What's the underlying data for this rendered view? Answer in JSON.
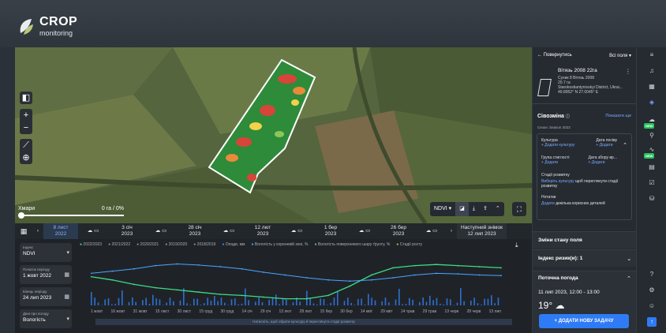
{
  "brand": {
    "name": "CROP",
    "sub": "monitoring"
  },
  "map": {
    "clouds_label": "Хмари",
    "clouds_value": "0 га / 0%",
    "index_select": "NDVI",
    "controls": [
      "layers-icon",
      "zoom-in-icon",
      "zoom-out-icon",
      "ruler-icon",
      "locate-icon"
    ]
  },
  "date_strip": {
    "items": [
      {
        "top": "8 лист",
        "bottom": "2022",
        "active": true
      },
      {
        "top": "3 січ",
        "bottom": "2023"
      },
      {
        "top": "28 січ",
        "bottom": "2023"
      },
      {
        "top": "12 лют",
        "bottom": "2023"
      },
      {
        "top": "1 бер",
        "bottom": "2023"
      },
      {
        "top": "26 бер",
        "bottom": "2023"
      }
    ],
    "next_label": "Наступний знімок",
    "next_date": "12 лип 2023"
  },
  "filters": {
    "index_label": "Індекс",
    "index_value": "NDVI",
    "start_label": "Початок періоду",
    "start_value": "1 жовт 2022",
    "end_label": "Кінець періоду",
    "end_value": "24 лип 2023",
    "data_label": "Дані про погоду",
    "data_value": "Вологість"
  },
  "legend": [
    {
      "label": "2022/2023",
      "color": "#3ddc84"
    },
    {
      "label": "2021/2022",
      "color": "#8a9099"
    },
    {
      "label": "2020/2021",
      "color": "#8a9099"
    },
    {
      "label": "2019/2020",
      "color": "#8a9099"
    },
    {
      "label": "2018/2019",
      "color": "#8a9099"
    },
    {
      "label": "Опади, мм",
      "color": "#3a8cff"
    },
    {
      "label": "Вологість у кореневій зоні, %",
      "color": "#4aa6ff"
    },
    {
      "label": "Вологість поверхневого шару ґрунту, %",
      "color": "#62b8d8"
    },
    {
      "label": "Стадії росту",
      "color": "#c9b45a"
    }
  ],
  "chart_data": {
    "type": "line",
    "x": [
      "1 жовт",
      "16 жовт",
      "31 жовт",
      "15 лист",
      "30 лист",
      "15 груд",
      "30 груд",
      "14 січ",
      "29 січ",
      "13 лют",
      "28 лют",
      "15 бер",
      "30 бер",
      "14 квіт",
      "29 квіт",
      "14 трав",
      "29 трав",
      "13 черв",
      "28 черв",
      "13 лип"
    ],
    "series": [
      {
        "name": "2022/2023",
        "values": [
          0.52,
          0.46,
          0.38,
          0.32,
          0.28,
          0.24,
          0.2,
          0.18,
          0.15,
          0.12,
          0.12,
          0.18,
          0.35,
          0.55,
          0.68,
          0.72,
          0.74,
          0.72,
          0.7,
          0.68
        ]
      },
      {
        "name": "Вологість у кореневій зоні, %",
        "values": [
          0.58,
          0.62,
          0.66,
          0.72,
          0.75,
          0.73,
          0.7,
          0.66,
          0.6,
          0.55,
          0.5,
          0.46,
          0.44,
          0.46,
          0.5,
          0.55,
          0.58,
          0.57,
          0.55,
          0.54
        ]
      }
    ],
    "xlabel": "",
    "ylabel": ""
  },
  "chart_hint": "Натисніть, щоб обрати культуру й переглянути стадії розвитку",
  "right_panel": {
    "back_label": "Повернутись",
    "filter_label": "Всі поля",
    "field": {
      "name": "Вітязь 2008 22га",
      "line1": "Сухик 8 Вітязь 2008",
      "line2": "20.7 га",
      "line3": "Starokostiantynivskyi District, Ukrai...",
      "line4": "49.8952° N 27.0045° E"
    },
    "rotation_title": "Сівозміна",
    "rotation_link": "Показати ще",
    "season": "Сезон: Season 2023",
    "crop_label": "Культура",
    "crop_link": "+ Додати культуру",
    "sowing_label": "Дата посіву",
    "sowing_link": "+ Додати",
    "maturity_label": "Група стиглості",
    "maturity_link": "+ Додати",
    "harvest_label": "Дата збору вр...",
    "harvest_link": "+ Додати",
    "stages_label": "Стадії розвитку",
    "stages_link": "Виберіть культуру",
    "stages_text": "щоб переглянути стадії розвитку",
    "notes_label": "Нотатки",
    "notes_link": "Додати",
    "notes_text": "декілька корисних деталей",
    "changes": "Зміни стану поля",
    "risk": "Індекс ризик(и): 1",
    "weather_title": "Поточна погода",
    "weather_date": "11 лип 2023, 12:00 - 13:00",
    "weather_temp": "19°",
    "add_task": "ДОДАТИ НОВУ ЗАДАЧУ"
  },
  "rail": {
    "new_label": "NEW"
  }
}
